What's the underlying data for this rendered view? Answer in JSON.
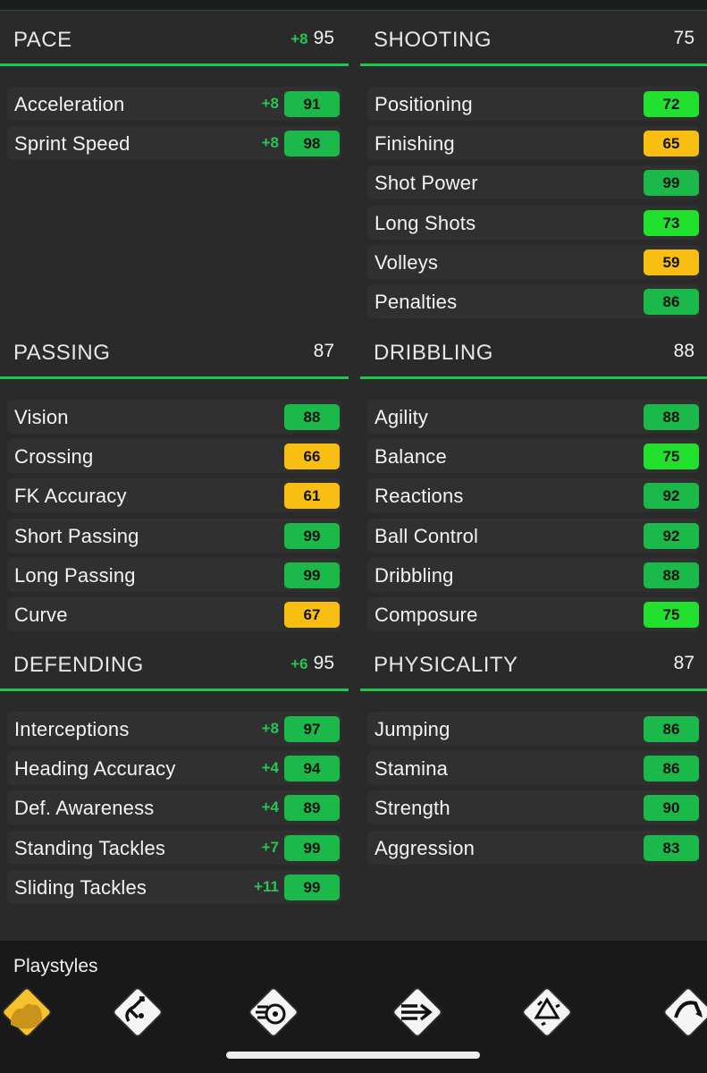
{
  "colors": {
    "accent_green": "#1ec84a",
    "rating_dark_green": "#1bb84a",
    "rating_bright_green": "#22e12e",
    "rating_yellow": "#f9be12"
  },
  "sections": {
    "pace": {
      "title": "PACE",
      "boost": "+8",
      "total": "95",
      "rows": [
        {
          "label": "Acceleration",
          "boost": "+8",
          "value": "91",
          "tier": "dark_green"
        },
        {
          "label": "Sprint Speed",
          "boost": "+8",
          "value": "98",
          "tier": "dark_green"
        }
      ]
    },
    "shooting": {
      "title": "SHOOTING",
      "boost": "",
      "total": "75",
      "rows": [
        {
          "label": "Positioning",
          "boost": "",
          "value": "72",
          "tier": "bright_green"
        },
        {
          "label": "Finishing",
          "boost": "",
          "value": "65",
          "tier": "yellow"
        },
        {
          "label": "Shot Power",
          "boost": "",
          "value": "99",
          "tier": "dark_green"
        },
        {
          "label": "Long Shots",
          "boost": "",
          "value": "73",
          "tier": "bright_green"
        },
        {
          "label": "Volleys",
          "boost": "",
          "value": "59",
          "tier": "yellow"
        },
        {
          "label": "Penalties",
          "boost": "",
          "value": "86",
          "tier": "dark_green"
        }
      ]
    },
    "passing": {
      "title": "PASSING",
      "boost": "",
      "total": "87",
      "rows": [
        {
          "label": "Vision",
          "boost": "",
          "value": "88",
          "tier": "dark_green"
        },
        {
          "label": "Crossing",
          "boost": "",
          "value": "66",
          "tier": "yellow"
        },
        {
          "label": "FK Accuracy",
          "boost": "",
          "value": "61",
          "tier": "yellow"
        },
        {
          "label": "Short Passing",
          "boost": "",
          "value": "99",
          "tier": "dark_green"
        },
        {
          "label": "Long Passing",
          "boost": "",
          "value": "99",
          "tier": "dark_green"
        },
        {
          "label": "Curve",
          "boost": "",
          "value": "67",
          "tier": "yellow"
        }
      ]
    },
    "dribbling": {
      "title": "DRIBBLING",
      "boost": "",
      "total": "88",
      "rows": [
        {
          "label": "Agility",
          "boost": "",
          "value": "88",
          "tier": "dark_green"
        },
        {
          "label": "Balance",
          "boost": "",
          "value": "75",
          "tier": "bright_green"
        },
        {
          "label": "Reactions",
          "boost": "",
          "value": "92",
          "tier": "dark_green"
        },
        {
          "label": "Ball Control",
          "boost": "",
          "value": "92",
          "tier": "dark_green"
        },
        {
          "label": "Dribbling",
          "boost": "",
          "value": "88",
          "tier": "dark_green"
        },
        {
          "label": "Composure",
          "boost": "",
          "value": "75",
          "tier": "bright_green"
        }
      ]
    },
    "defending": {
      "title": "DEFENDING",
      "boost": "+6",
      "total": "95",
      "rows": [
        {
          "label": "Interceptions",
          "boost": "+8",
          "value": "97",
          "tier": "dark_green"
        },
        {
          "label": "Heading Accuracy",
          "boost": "+4",
          "value": "94",
          "tier": "dark_green"
        },
        {
          "label": "Def. Awareness",
          "boost": "+4",
          "value": "89",
          "tier": "dark_green"
        },
        {
          "label": "Standing Tackles",
          "boost": "+7",
          "value": "99",
          "tier": "dark_green"
        },
        {
          "label": "Sliding Tackles",
          "boost": "+11",
          "value": "99",
          "tier": "dark_green"
        }
      ]
    },
    "physicality": {
      "title": "PHYSICALITY",
      "boost": "",
      "total": "87",
      "rows": [
        {
          "label": "Jumping",
          "boost": "",
          "value": "86",
          "tier": "dark_green"
        },
        {
          "label": "Stamina",
          "boost": "",
          "value": "86",
          "tier": "dark_green"
        },
        {
          "label": "Strength",
          "boost": "",
          "value": "90",
          "tier": "dark_green"
        },
        {
          "label": "Aggression",
          "boost": "",
          "value": "83",
          "tier": "dark_green"
        }
      ]
    }
  },
  "playstyles": {
    "title": "Playstyles",
    "items": [
      {
        "label": "RUISER",
        "icon": "bruiser-icon",
        "gold": true
      },
      {
        "label": "INTERCEPT",
        "icon": "intercept-icon",
        "gold": false
      },
      {
        "label": "POWER SHOT",
        "icon": "power-shot-icon",
        "gold": false
      },
      {
        "label": "PINGED PASS",
        "icon": "pinged-pass-icon",
        "gold": false
      },
      {
        "label": "TIKI TAKA",
        "icon": "tiki-taka-icon",
        "gold": false
      },
      {
        "label": "LONG BALL",
        "icon": "long-ball-icon",
        "gold": false
      }
    ]
  }
}
